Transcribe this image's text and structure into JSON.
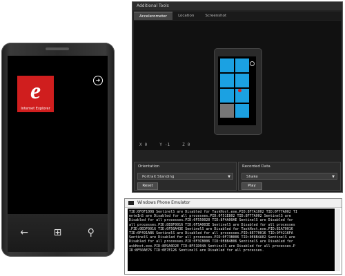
{
  "phone": {
    "tile_label": "Internet Explorer",
    "hw_buttons": [
      {
        "icon": "back-icon",
        "glyph": "←"
      },
      {
        "icon": "windows-start-icon",
        "glyph": "⊞"
      },
      {
        "icon": "search-icon",
        "glyph": "⚲"
      }
    ]
  },
  "tools": {
    "title": "Additional Tools",
    "tabs": [
      "Accelerometer",
      "Location",
      "Screenshot"
    ],
    "active_tab": "Accelerometer",
    "axes": {
      "x": "0",
      "y": "-1",
      "z": "0"
    },
    "orientation": {
      "title": "Orientation",
      "value": "Portrait Standing",
      "button": "Reset"
    },
    "recorded": {
      "title": "Recorded Data",
      "value": "Shake",
      "button": "Play"
    }
  },
  "console": {
    "title": "Windows Phone Emulator",
    "lines": [
      "TID:0F0F1008 SentinelS are Disabled for TaskHost.exe.PID:8F7A1002 TID:0F77A002 TI",
      "enteInS are Disabled for all processes.PID:0F51E802 TID:8F77A002 SentinelS are",
      "Disabled for all processes.PID:0F550020 TID:8F4A00AE SentinelS are Disabled for",
      "all processes.PID:8E8F0016 TID:0F5A003E SentinelS are Disabled for all processes",
      ".PID:0EDF0016 TID:0F50A43E SentinelS are Disabled for TaskHost.exe.PID:81A70016",
      "TID:0F491AB6 SentinelS are Disabled for all processes.PID:8E770016 TID:9F4216FA",
      "SentinelS are Disabled for all processes.PID:0F73B006 TID:0E8B4A02 SentinelS are",
      "Disabled for all processes.PID:0F3CB006 TID:0E8B4B06 SentinelS are Disabled for",
      "askHost.exe.PID:8E9A0D2E TID:8F51D04A SentinelS are Disabled for all processes.P",
      "ID:8F50AE76 TID:0E7E126 SentinelS are Disabled for all processes."
    ]
  }
}
